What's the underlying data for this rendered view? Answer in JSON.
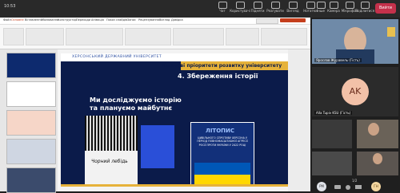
{
  "teams": {
    "time": "10:53",
    "buttons": [
      {
        "label": "Чат",
        "icon": "chat-icon"
      },
      {
        "label": "Користувачі",
        "icon": "people-icon"
      },
      {
        "label": "Підняти",
        "icon": "raise-hand-icon"
      },
      {
        "label": "Реагувати",
        "icon": "react-icon"
      },
      {
        "label": "Вигляд",
        "icon": "view-icon"
      },
      {
        "label": "Нотатки",
        "icon": "notes-icon"
      },
      {
        "label": "Інше",
        "icon": "more-icon"
      },
      {
        "label": "Камера",
        "icon": "camera-icon"
      },
      {
        "label": "Мікрофон",
        "icon": "mic-icon"
      },
      {
        "label": "Поділитися",
        "icon": "share-icon"
      }
    ],
    "leave": "Вийти"
  },
  "ppt": {
    "tabs": [
      "Файл",
      "Основне",
      "Вставлення",
      "Малювання",
      "Конструктор",
      "Переходи",
      "Анімація",
      "Показ слайдів",
      "Запис",
      "Рецензування",
      "Вигляд",
      "Довідка"
    ],
    "slide": {
      "university": "ХЕРСОНСЬКИЙ ДЕРЖАВНИЙ УНІВЕРСИТЕТ",
      "title": "Ключові пріоритети розвитку університету",
      "section": "4. Збереження історії",
      "lead": "Ми досліджуємо історію та плануємо майбутнє",
      "book_left": "Чорний лебідь",
      "book_right_title": "ЛІТОПИС",
      "book_right_sub": "ЦИВІЛЬНОГО СПРОТИВУ ХЕРСОНА У ПЕРІОД ПОВНОМАСШТАБНОЇ АГРЕСІЇ РОСІЇ ПРОТИ УКРАЇНИ У 2022 РОЦІ"
    }
  },
  "video": {
    "tiles": [
      {
        "name": "Ярослав Журавель (Гість)"
      },
      {
        "name": "Alla Tupiv KSU (Гість)",
        "initials": "AK"
      },
      {
        "name": "",
        "initials": ""
      },
      {
        "name": "",
        "initials": ""
      }
    ],
    "pager": "1/2",
    "bottom_avatars": [
      "PM",
      "ГН"
    ]
  },
  "colors": {
    "accent": "#c4314b",
    "avatar_ak": "#f2c1a8",
    "slide_bg": "#0b1b4a"
  }
}
